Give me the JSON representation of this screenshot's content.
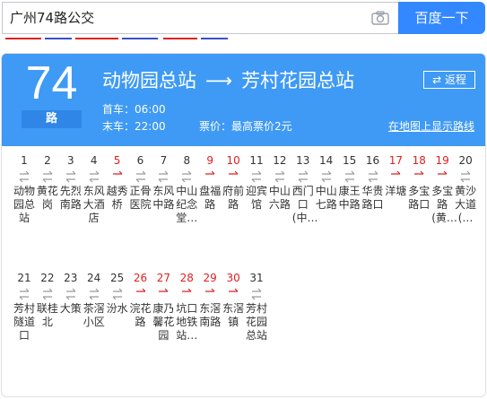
{
  "search": {
    "query": "广州74路公交",
    "button_label": "百度一下",
    "icon": "camera-icon"
  },
  "route": {
    "number": "74",
    "suffix": "路",
    "from": "动物园总站",
    "arrow": "⟶",
    "to": "芳村花园总站",
    "reverse_label": "⇄ 返程",
    "first_bus": "首车：06:00",
    "last_bus": "末车：22:00",
    "fare": "票价：最高票价2元",
    "map_link": "在地图上显示路线"
  },
  "colors": {
    "header": "#3e9af5",
    "accent": "#3388ff",
    "terminal_red": "#e02020"
  },
  "stops_row1": [
    {
      "num": "1",
      "name": "动物园总站",
      "red": false
    },
    {
      "num": "2",
      "name": "黄花岗",
      "red": false
    },
    {
      "num": "3",
      "name": "先烈南路",
      "red": false
    },
    {
      "num": "4",
      "name": "东风大酒店",
      "red": false
    },
    {
      "num": "5",
      "name": "越秀桥",
      "red": true
    },
    {
      "num": "6",
      "name": "正骨医院",
      "red": false
    },
    {
      "num": "7",
      "name": "东风中路",
      "red": false
    },
    {
      "num": "8",
      "name": "中山纪念堂…",
      "red": false
    },
    {
      "num": "9",
      "name": "盘福路",
      "red": true
    },
    {
      "num": "10",
      "name": "府前路",
      "red": true
    },
    {
      "num": "11",
      "name": "迎宾馆",
      "red": false
    },
    {
      "num": "12",
      "name": "中山六路",
      "red": false
    },
    {
      "num": "13",
      "name": "西门口(中…",
      "red": false
    },
    {
      "num": "14",
      "name": "中山七路",
      "red": false
    },
    {
      "num": "15",
      "name": "康王中路",
      "red": false
    },
    {
      "num": "16",
      "name": "华贵路口",
      "red": false
    },
    {
      "num": "17",
      "name": "洋塘",
      "red": true
    },
    {
      "num": "18",
      "name": "多宝路口",
      "red": true
    },
    {
      "num": "19",
      "name": "多宝路(黄…",
      "red": true
    },
    {
      "num": "20",
      "name": "黄沙大道(…",
      "red": false
    }
  ],
  "stops_row2": [
    {
      "num": "21",
      "name": "芳村隧道口",
      "red": false
    },
    {
      "num": "22",
      "name": "联桂北",
      "red": false
    },
    {
      "num": "23",
      "name": "大策",
      "red": false
    },
    {
      "num": "24",
      "name": "茶滘小区",
      "red": false
    },
    {
      "num": "25",
      "name": "汾水",
      "red": false
    },
    {
      "num": "26",
      "name": "浣花路",
      "red": true
    },
    {
      "num": "27",
      "name": "康乃馨花园",
      "red": true
    },
    {
      "num": "28",
      "name": "坑口地铁站…",
      "red": true
    },
    {
      "num": "29",
      "name": "东滘南路",
      "red": true
    },
    {
      "num": "30",
      "name": "东滘镇",
      "red": true
    },
    {
      "num": "31",
      "name": "芳村花园总站",
      "red": false
    }
  ]
}
